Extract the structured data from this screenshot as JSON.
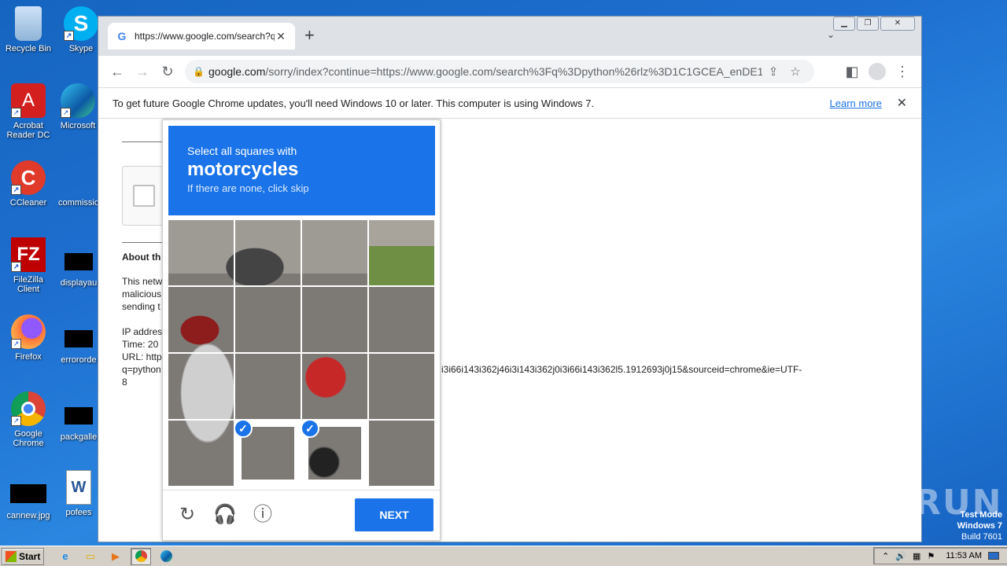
{
  "desktop": {
    "icons": [
      {
        "label": "Recycle Bin",
        "icon": "recycle-bin-icon"
      },
      {
        "label": "Skype",
        "icon": "skype-icon"
      },
      {
        "label": "Acrobat Reader DC",
        "icon": "acrobat-icon"
      },
      {
        "label": "Microsoft",
        "icon": "edge-icon"
      },
      {
        "label": "CCleaner",
        "icon": "ccleaner-icon"
      },
      {
        "label": "commissio",
        "icon": "document-icon"
      },
      {
        "label": "FileZilla Client",
        "icon": "filezilla-icon"
      },
      {
        "label": "displayau",
        "icon": "file-icon"
      },
      {
        "label": "Firefox",
        "icon": "firefox-icon"
      },
      {
        "label": "errororde",
        "icon": "file-icon"
      },
      {
        "label": "Google Chrome",
        "icon": "chrome-icon"
      },
      {
        "label": "packgalle",
        "icon": "file-icon"
      },
      {
        "label": "cannew.jpg",
        "icon": "image-icon"
      },
      {
        "label": "pofees",
        "icon": "word-icon"
      }
    ]
  },
  "browser": {
    "tab_title": "https://www.google.com/search?q=",
    "url_host": "google.com",
    "url_rest": "/sorry/index?continue=https://www.google.com/search%3Fq%3Dpython%26rlz%3D1C1GCEA_enDE1...",
    "infobar_text": "To get future Google Chrome updates, you'll need Windows 10 or later. This computer is using Windows 7.",
    "infobar_link": "Learn more"
  },
  "page": {
    "about_heading": "About th",
    "para_lines": [
      "This netw",
      "malicious",
      "sending t"
    ],
    "ip_line": "IP addres",
    "time_line": "Time: 20",
    "url_line": "URL: http",
    "q_line_start": "q=python",
    "q_line_end": "i3i66i143i362j46i3i143i362j0i3i66i143i362l5.1912693j0j15&sourceid=chrome&ie=UTF-",
    "q_line_wrap": "8"
  },
  "captcha": {
    "instruction": "Select all squares with",
    "target": "motorcycles",
    "hint": "If there are none, click skip",
    "selected_tiles": [
      13,
      14
    ],
    "next_label": "NEXT"
  },
  "watermark": {
    "text": "ANY RUN"
  },
  "testmode": {
    "line1": "Test Mode",
    "line2": "Windows 7",
    "line3": "Build 7601"
  },
  "taskbar": {
    "start_label": "Start",
    "clock": "11:53 AM"
  }
}
